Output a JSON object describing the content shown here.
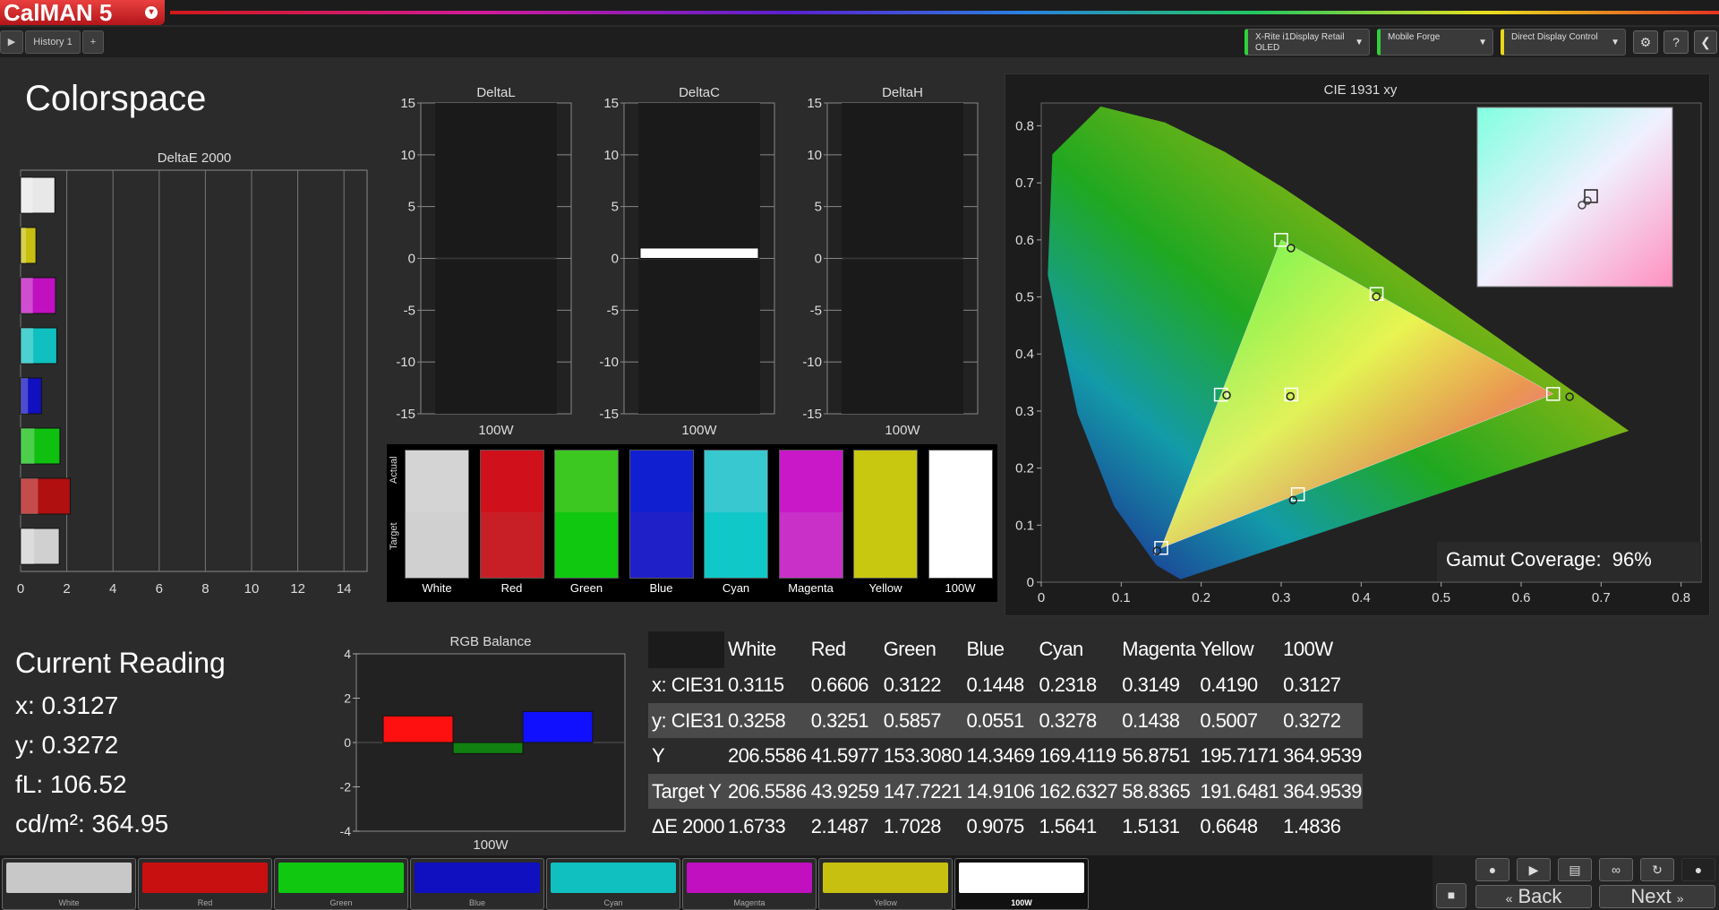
{
  "app": {
    "logo": "CalMAN 5",
    "logo_dropdown": "▾"
  },
  "tabs": {
    "history_tab": "History 1",
    "add_tab": "+"
  },
  "devices": [
    {
      "line1": "X-Rite i1Display Retail",
      "line2": "OLED",
      "accent": "#2fd13a"
    },
    {
      "line1": "Mobile Forge",
      "line2": "",
      "accent": "#2fd13a"
    },
    {
      "line1": "Direct Display Control",
      "line2": "",
      "accent": "#e8d81a"
    }
  ],
  "page": {
    "title": "Colorspace"
  },
  "deltae_chart": {
    "title": "DeltaE 2000",
    "xticks": [
      "0",
      "2",
      "4",
      "6",
      "8",
      "10",
      "12",
      "14"
    ],
    "xlim": [
      0,
      15
    ],
    "bars": [
      {
        "name": "100W",
        "value": 1.4836,
        "color": "#e8e8e8"
      },
      {
        "name": "Yellow",
        "value": 0.6648,
        "color": "#c8c010"
      },
      {
        "name": "Magenta",
        "value": 1.5131,
        "color": "#c010c0"
      },
      {
        "name": "Cyan",
        "value": 1.5641,
        "color": "#10c0c0"
      },
      {
        "name": "Blue",
        "value": 0.9075,
        "color": "#1010c0"
      },
      {
        "name": "Green",
        "value": 1.7028,
        "color": "#10c010"
      },
      {
        "name": "Red",
        "value": 2.1487,
        "color": "#b01010"
      },
      {
        "name": "White",
        "value": 1.6733,
        "color": "#d0d0d0"
      }
    ]
  },
  "delta_charts": [
    {
      "title": "DeltaL",
      "xlabel": "100W",
      "value": 0.0
    },
    {
      "title": "DeltaC",
      "xlabel": "100W",
      "value": 1.0
    },
    {
      "title": "DeltaH",
      "xlabel": "100W",
      "value": 0.0
    }
  ],
  "delta_yticks": [
    "15",
    "10",
    "5",
    "0",
    "-5",
    "-10",
    "-15"
  ],
  "swatch_panel": {
    "actual_label": "Actual",
    "target_label": "Target",
    "swatches": [
      {
        "label": "White",
        "actual": "#d4d4d4",
        "target": "#d0d0d0"
      },
      {
        "label": "Red",
        "actual": "#d0101a",
        "target": "#c81f26"
      },
      {
        "label": "Green",
        "actual": "#3cc820",
        "target": "#10c810"
      },
      {
        "label": "Blue",
        "actual": "#1020d0",
        "target": "#2020c8"
      },
      {
        "label": "Cyan",
        "actual": "#38c8d0",
        "target": "#10c8c8"
      },
      {
        "label": "Magenta",
        "actual": "#c818c8",
        "target": "#c830c8"
      },
      {
        "label": "Yellow",
        "actual": "#c8c810",
        "target": "#c8c810"
      },
      {
        "label": "100W",
        "actual": "#ffffff",
        "target": "#ffffff"
      }
    ]
  },
  "cie": {
    "title": "CIE 1931 xy",
    "xticks": [
      "0",
      "0.1",
      "0.2",
      "0.3",
      "0.4",
      "0.5",
      "0.6",
      "0.7",
      "0.8"
    ],
    "yticks": [
      "0.8",
      "0.7",
      "0.6",
      "0.5",
      "0.4",
      "0.3",
      "0.2",
      "0.1",
      "0"
    ],
    "gamut_label": "Gamut Coverage:",
    "gamut_value": "96%",
    "targets": [
      {
        "name": "White",
        "x": 0.3127,
        "y": 0.329
      },
      {
        "name": "Red",
        "x": 0.64,
        "y": 0.33
      },
      {
        "name": "Green",
        "x": 0.3,
        "y": 0.6
      },
      {
        "name": "Blue",
        "x": 0.15,
        "y": 0.06
      },
      {
        "name": "Cyan",
        "x": 0.2246,
        "y": 0.3287
      },
      {
        "name": "Magenta",
        "x": 0.3209,
        "y": 0.1542
      },
      {
        "name": "Yellow",
        "x": 0.4193,
        "y": 0.5053
      }
    ],
    "actuals": [
      {
        "name": "White",
        "x": 0.3115,
        "y": 0.3258
      },
      {
        "name": "Red",
        "x": 0.6606,
        "y": 0.3251
      },
      {
        "name": "Green",
        "x": 0.3122,
        "y": 0.5857
      },
      {
        "name": "Blue",
        "x": 0.1448,
        "y": 0.0551
      },
      {
        "name": "Cyan",
        "x": 0.2318,
        "y": 0.3278
      },
      {
        "name": "Magenta",
        "x": 0.3149,
        "y": 0.1438
      },
      {
        "name": "Yellow",
        "x": 0.419,
        "y": 0.5007
      }
    ]
  },
  "current_reading": {
    "title": "Current Reading",
    "x": "x: 0.3127",
    "y": "y: 0.3272",
    "fl": "fL: 106.52",
    "cdm2": "cd/m²: 364.95"
  },
  "rgb_balance": {
    "title": "RGB Balance",
    "xlabel": "100W",
    "yticks": [
      "4",
      "2",
      "0",
      "-2",
      "-4"
    ],
    "ylim": [
      -4,
      4
    ],
    "bars": [
      {
        "name": "Red",
        "value": 1.2,
        "color": "#ff1010"
      },
      {
        "name": "Green",
        "value": -0.5,
        "color": "#108010"
      },
      {
        "name": "Blue",
        "value": 1.4,
        "color": "#1010ff"
      }
    ]
  },
  "table": {
    "headers": [
      "",
      "White",
      "Red",
      "Green",
      "Blue",
      "Cyan",
      "Magenta",
      "Yellow",
      "100W"
    ],
    "rows": [
      [
        "x: CIE31",
        "0.3115",
        "0.6606",
        "0.3122",
        "0.1448",
        "0.2318",
        "0.3149",
        "0.4190",
        "0.3127"
      ],
      [
        "y: CIE31",
        "0.3258",
        "0.3251",
        "0.5857",
        "0.0551",
        "0.3278",
        "0.1438",
        "0.5007",
        "0.3272"
      ],
      [
        "Y",
        "206.5586",
        "41.5977",
        "153.3080",
        "14.3469",
        "169.4119",
        "56.8751",
        "195.7171",
        "364.9539"
      ],
      [
        "Target Y",
        "206.5586",
        "43.9259",
        "147.7221",
        "14.9106",
        "162.6327",
        "58.8365",
        "191.6481",
        "364.9539"
      ],
      [
        "ΔE 2000",
        "1.6733",
        "2.1487",
        "1.7028",
        "0.9075",
        "1.5641",
        "1.5131",
        "0.6648",
        "1.4836"
      ]
    ]
  },
  "bottom_swatches": [
    {
      "label": "White",
      "color": "#c8c8c8"
    },
    {
      "label": "Red",
      "color": "#c81010"
    },
    {
      "label": "Green",
      "color": "#10c810"
    },
    {
      "label": "Blue",
      "color": "#1010c0"
    },
    {
      "label": "Cyan",
      "color": "#10c0c0"
    },
    {
      "label": "Magenta",
      "color": "#c010c0"
    },
    {
      "label": "Yellow",
      "color": "#c8c010"
    },
    {
      "label": "100W",
      "color": "#ffffff"
    }
  ],
  "nav": {
    "back": "Back",
    "next": "Next"
  }
}
